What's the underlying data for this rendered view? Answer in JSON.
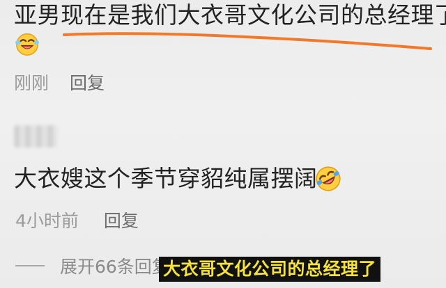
{
  "comment_1": {
    "text": "亚男现在是我们大衣哥文化公司的总经理了",
    "emoji": "laughing-wink-emoji",
    "time": "刚刚",
    "reply_label": "回复"
  },
  "comment_2": {
    "author_blurred": true,
    "text": "大衣嫂这个季节穿貂纯属摆阔",
    "emoji": "rofl-emoji",
    "time": "4小时前",
    "reply_label": "回复"
  },
  "expand_replies": {
    "label": "展开66条回复"
  },
  "subtitle": {
    "text": "大衣哥文化公司的总经理了"
  },
  "colors": {
    "underline_annotation": "#f07a2a",
    "subtitle_background": "#111111",
    "subtitle_text": "#f5e23a"
  }
}
